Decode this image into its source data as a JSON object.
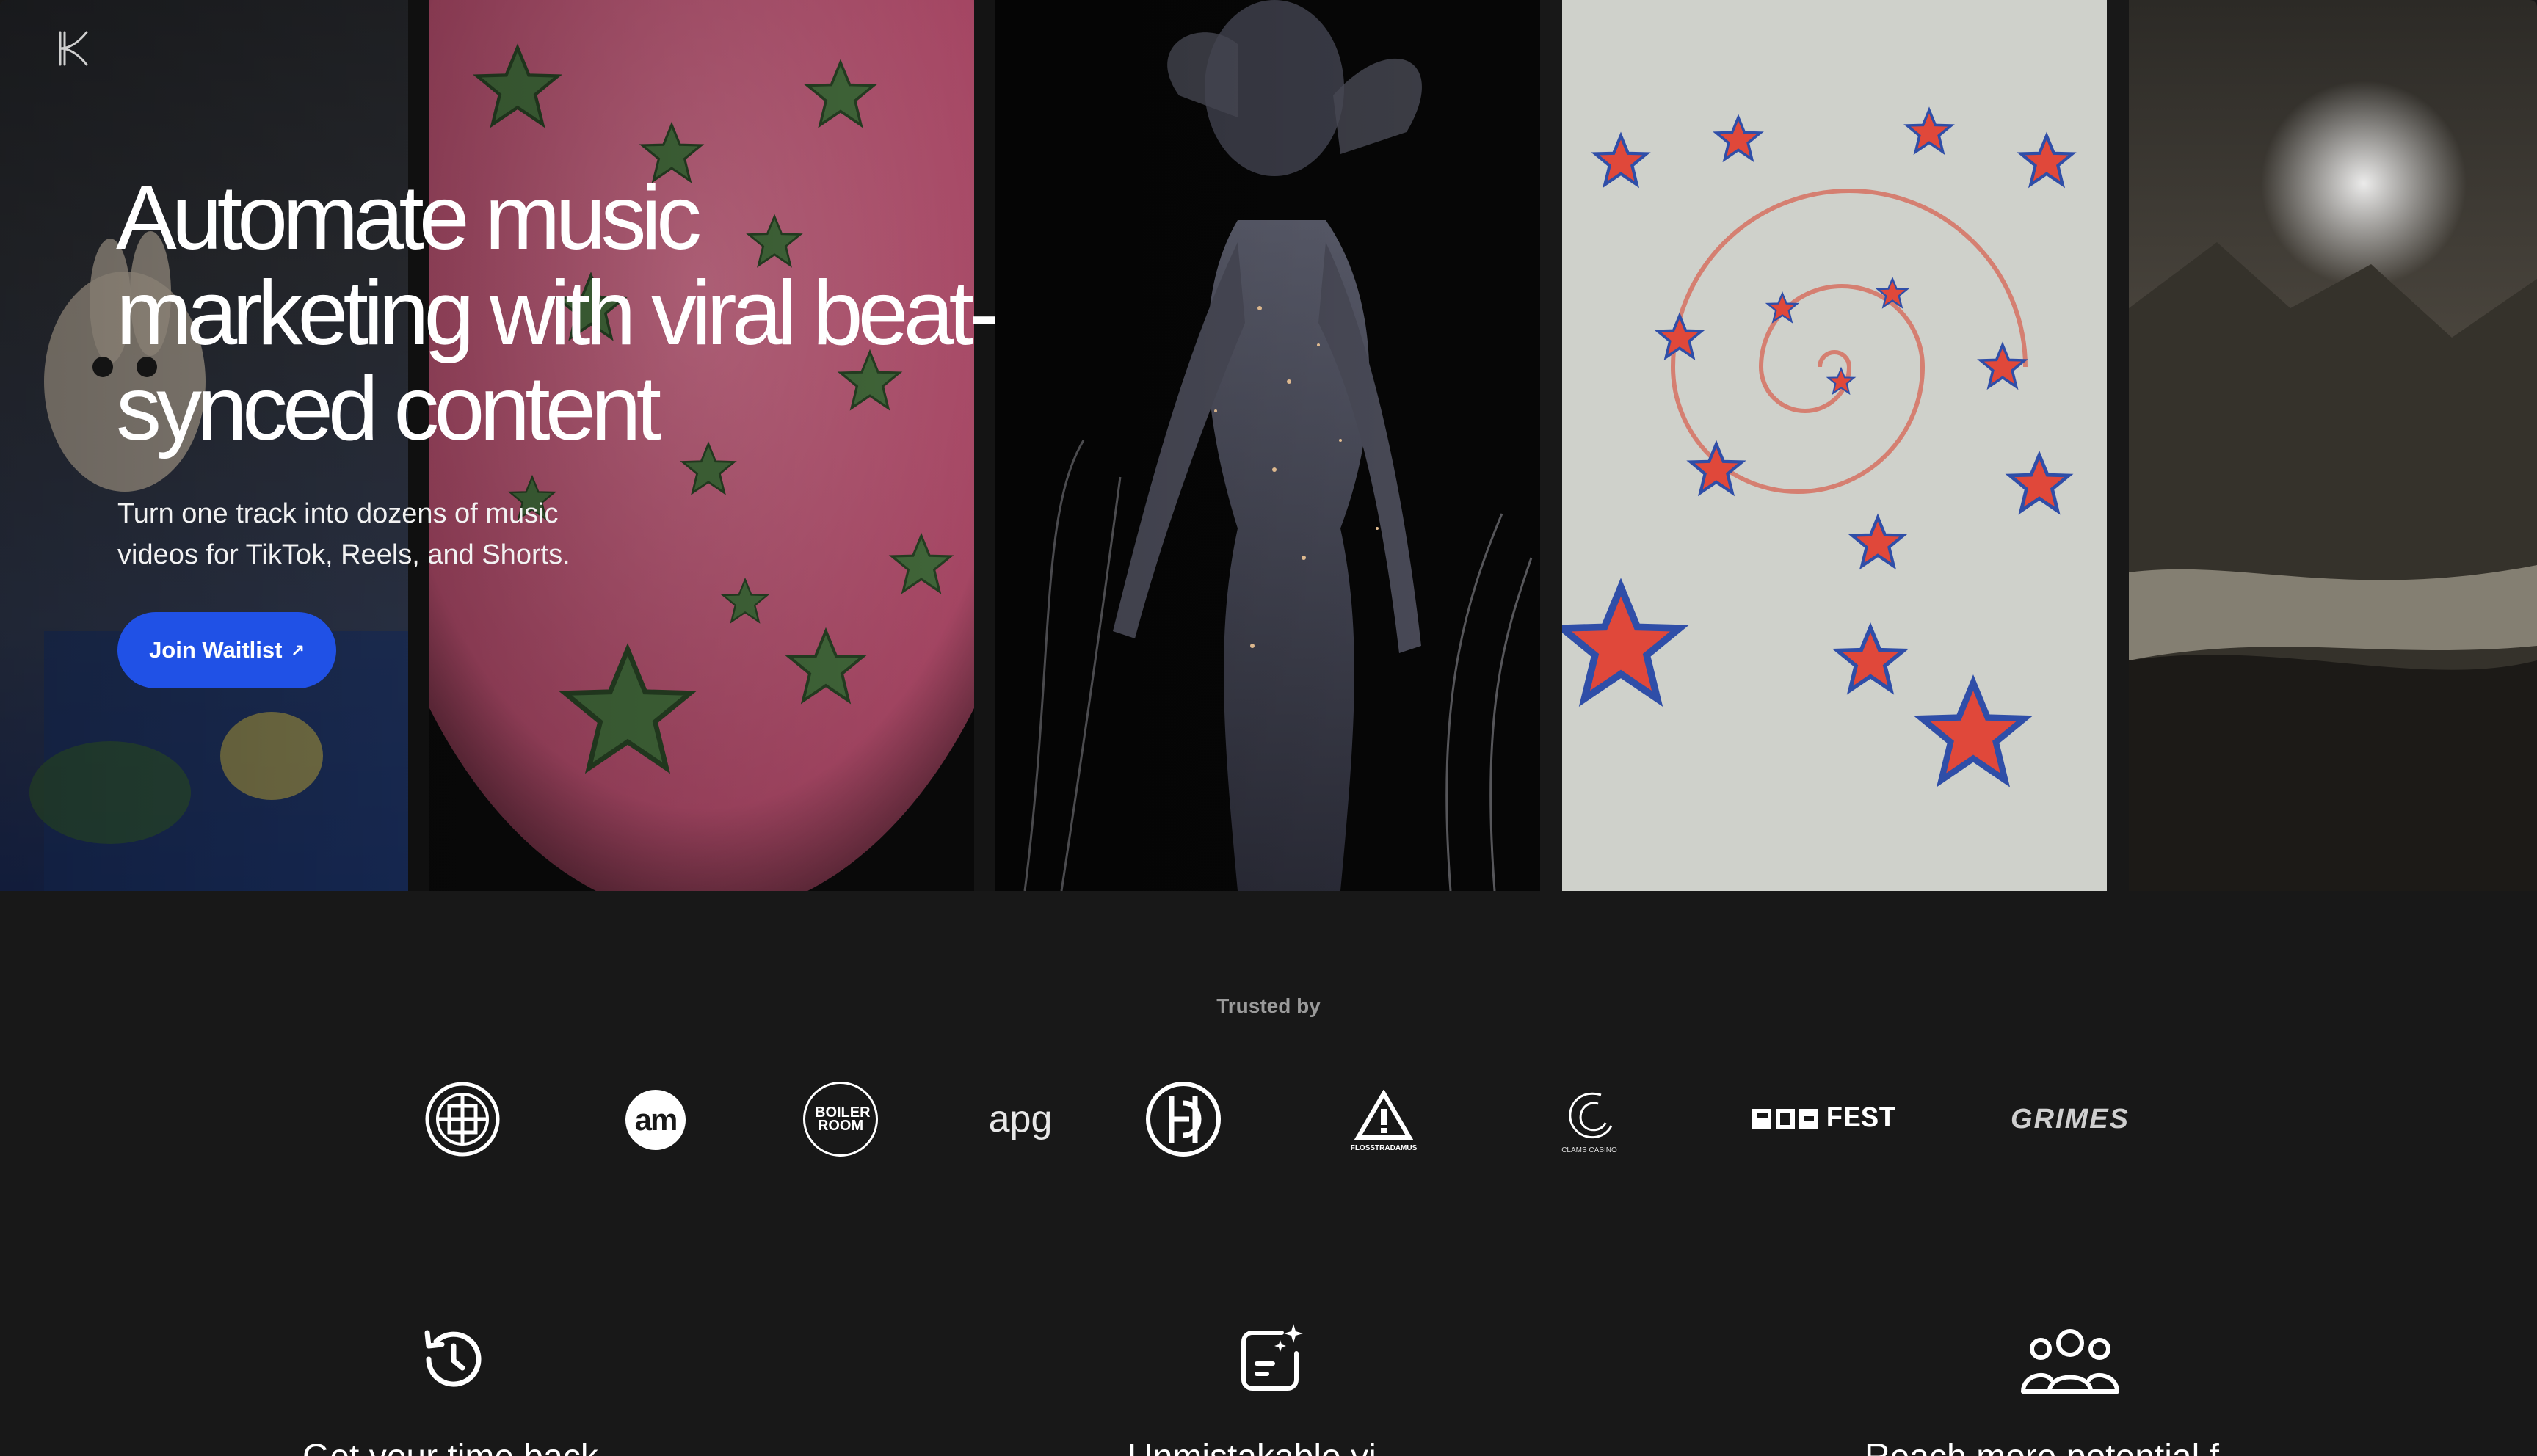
{
  "brand": {
    "logo_icon": "k-logo-icon"
  },
  "hero": {
    "headline": "Automate music marketing with viral beat-synced content",
    "subheadline": "Turn one track into dozens of music videos for TikTok, Reels, and Shorts.",
    "cta_label": "Join Waitlist",
    "cta_icon": "arrow-up-right-icon",
    "accent_color": "#2051E6"
  },
  "trusted": {
    "label": "Trusted by",
    "logos": [
      {
        "name": "geometric-circle-logo"
      },
      {
        "name": "am-logo",
        "text": "am"
      },
      {
        "name": "boiler-room-logo",
        "text": "BOILER ROOM"
      },
      {
        "name": "apg-logo",
        "text": "apg"
      },
      {
        "name": "circle-glyph-logo"
      },
      {
        "name": "flosstradamus-logo",
        "text": "FLOSSTRADAMUS"
      },
      {
        "name": "clams-casino-logo",
        "text": "CLAMS CASINO"
      },
      {
        "name": "fest-logo",
        "text": "FEST"
      },
      {
        "name": "grimes-logo",
        "text": "GRIMES"
      }
    ]
  },
  "features": [
    {
      "icon": "history-clock-icon",
      "title": "Get your time back"
    },
    {
      "icon": "sparkle-message-icon",
      "title": "Unmistakable vi"
    },
    {
      "icon": "users-group-icon",
      "title": "Reach more potential f"
    }
  ]
}
